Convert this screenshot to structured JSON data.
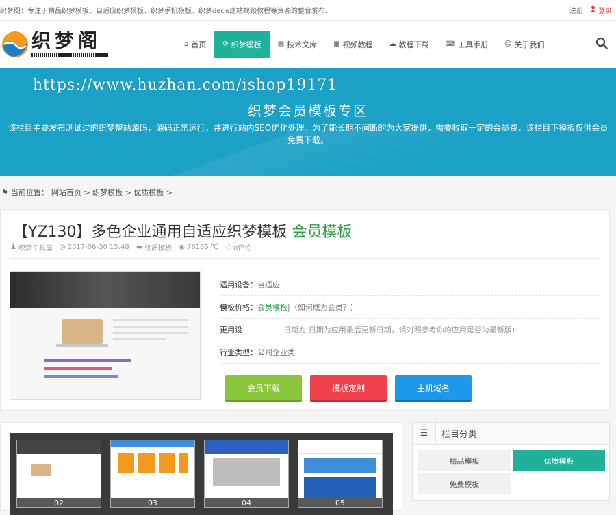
{
  "topbar": {
    "notice": "织梦阁：专注于精品织梦模板、自适应织梦模板、织梦手机模板、织梦dede建站视频教程等资源的整合发布。",
    "register": "注册",
    "login": "登录"
  },
  "logo": {
    "title": "织梦阁",
    "subtitle": "WWW.DEDECMS.COM"
  },
  "nav": {
    "items": [
      {
        "label": "首页",
        "icon": "home-icon"
      },
      {
        "label": "织梦模板",
        "icon": "refresh-icon"
      },
      {
        "label": "技术文库",
        "icon": "document-icon"
      },
      {
        "label": "视频教程",
        "icon": "film-icon"
      },
      {
        "label": "教程下载",
        "icon": "cloud-download-icon"
      },
      {
        "label": "工具手册",
        "icon": "keyboard-icon"
      },
      {
        "label": "关于我们",
        "icon": "smile-icon"
      }
    ]
  },
  "banner": {
    "url": "https://www.huzhan.com/ishop19171",
    "title": "织梦会员模板专区",
    "desc": "该栏目主要发布测试过的织梦整站源码，源码正常运行，并进行站内SEO优化处理。为了能长期不间断的为大家提供，需要收取一定的会员费，该栏目下模板仅供会员免费下载。"
  },
  "breadcrumb": {
    "prefix": "当前位置：",
    "path": "网站首页 > 织梦模板 > 优质模板 >"
  },
  "post": {
    "title": "【YZ130】多色企业通用自适应织梦模板",
    "tag": "会员模板",
    "author": "织梦工具屋",
    "date": "2017-06-30 15:48",
    "category": "优质模板",
    "views": "76135 ℃",
    "comments": "0评论"
  },
  "info": {
    "device_label": "适用设备：",
    "device_value": "自适应",
    "price_label": "模板价格：",
    "price_value": "会员模板",
    "price_note": "|（如何成为会员？）",
    "update_label": "更用设",
    "update_value": "日期为:日期为应用最后更新日期，请对照参考你的应用是否为最新版)",
    "industry_label": "行业类型：",
    "industry_value": "公司企业类"
  },
  "buttons": {
    "download": "会员下载",
    "custom": "模板定制",
    "domain": "主机域名"
  },
  "gallery": {
    "numbers": [
      "02",
      "03",
      "04",
      "05"
    ]
  },
  "sidebar": {
    "title": "栏目分类",
    "categories": [
      "精品模板",
      "优质模板",
      "免费模板"
    ]
  },
  "colors": {
    "accent": "#1fb19a",
    "banner": "#1ba0c6",
    "green_btn": "#8ac63a",
    "red_btn": "#f0424e",
    "blue_btn": "#1d97ea"
  }
}
